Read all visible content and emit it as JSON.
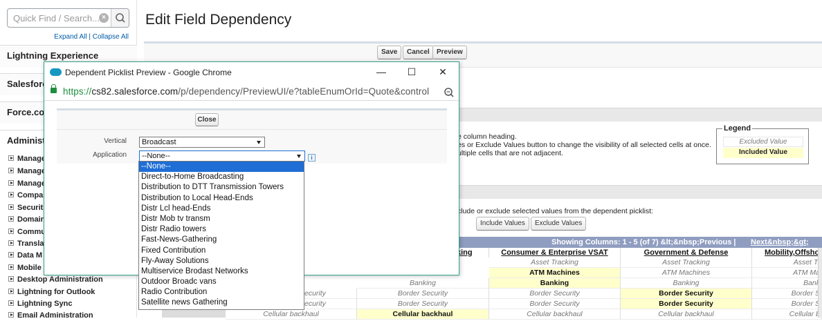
{
  "sidebar": {
    "search_placeholder": "Quick Find / Search...",
    "expand_all": "Expand All",
    "collapse_all": "Collapse All",
    "separator": "|",
    "groups": [
      "Lightning Experience",
      "Salesforce",
      "Force.com",
      "Administ"
    ],
    "items": [
      "Manage",
      "Manage",
      "Manage",
      "Compa",
      "Securit",
      "Domain",
      "Commu",
      "Transla",
      "Data M",
      "Mobile",
      "Desktop Administration",
      "Lightning for Outlook",
      "Lightning Sync",
      "Email Administration"
    ]
  },
  "main": {
    "title": "Edit Field Dependency",
    "buttons": {
      "save": "Save",
      "cancel": "Cancel",
      "preview": "Preview",
      "include": "Include Values",
      "exclude": "Exclude Values"
    },
    "help": {
      "line1": "e column heading.",
      "line2": "es or Exclude Values button to change the visibility of all selected cells at once.",
      "line3": "ultiple cells that are not adjacent.",
      "line4": "clude or exclude selected values from the dependent picklist:"
    },
    "legend": {
      "title": "Legend",
      "excluded": "Excluded Value",
      "included": "Included Value"
    },
    "grid": {
      "showing": "Showing Columns: 1 - 5 (of 7) &lt;&nbsp;Previous |",
      "next": "Next&nbsp;&gt;",
      "columns": [
        "king",
        "Consumer & Enterprise VSAT",
        "Government & Defense",
        "Mobility,Offsho"
      ],
      "rows": [
        [
          "",
          "Asset Tracking",
          "Asset Tracking",
          "Asset Tr"
        ],
        [
          "",
          "ATM Machines",
          "ATM Machines",
          "ATM Ma"
        ],
        [
          "Banking",
          "Banking",
          "Banking",
          "Bank"
        ],
        [
          "Border Security",
          "Border Security",
          "Border Security",
          "Border S"
        ],
        [
          "Border Security",
          "Border Security",
          "Border Security",
          "Border S"
        ],
        [
          "Cellular backhaul",
          "Cellular backhaul",
          "Cellular backhaul",
          "Cellular b"
        ]
      ],
      "left_fragments": [
        "ecurity",
        "ecurity",
        "Cellular backhaul"
      ]
    }
  },
  "popup": {
    "window_title": "Dependent Picklist Preview - Google Chrome",
    "url_scheme": "https://",
    "url_host": "cs82.salesforce.com",
    "url_path": "/p/dependency/PreviewUI/e?tableEnumOrId=Quote&control",
    "close_button": "Close",
    "vertical_label": "Vertical",
    "vertical_value": "Broadcast",
    "application_label": "Application",
    "application_value": "--None--",
    "info_icon_text": "i",
    "options": [
      "--None--",
      "Direct-to-Home Broadcasting",
      "Distribution to DTT Transmission Towers",
      "Distribution to Local Head-Ends",
      "Distr Lcl head-Ends",
      "Distr Mob tv transm",
      "Distr Radio towers",
      "Fast-News-Gathering",
      "Fixed Contribution",
      "Fly-Away Solutions",
      "Multiservice Brodast Networks",
      "Outdoor Broadc vans",
      "Radio Contribution",
      "Satellite news Gathering"
    ]
  },
  "colors": {
    "accent": "#1e6ed6",
    "included_bg": "#ffffcc",
    "grid_header": "#8f9dc0",
    "popup_border": "#36a089"
  }
}
